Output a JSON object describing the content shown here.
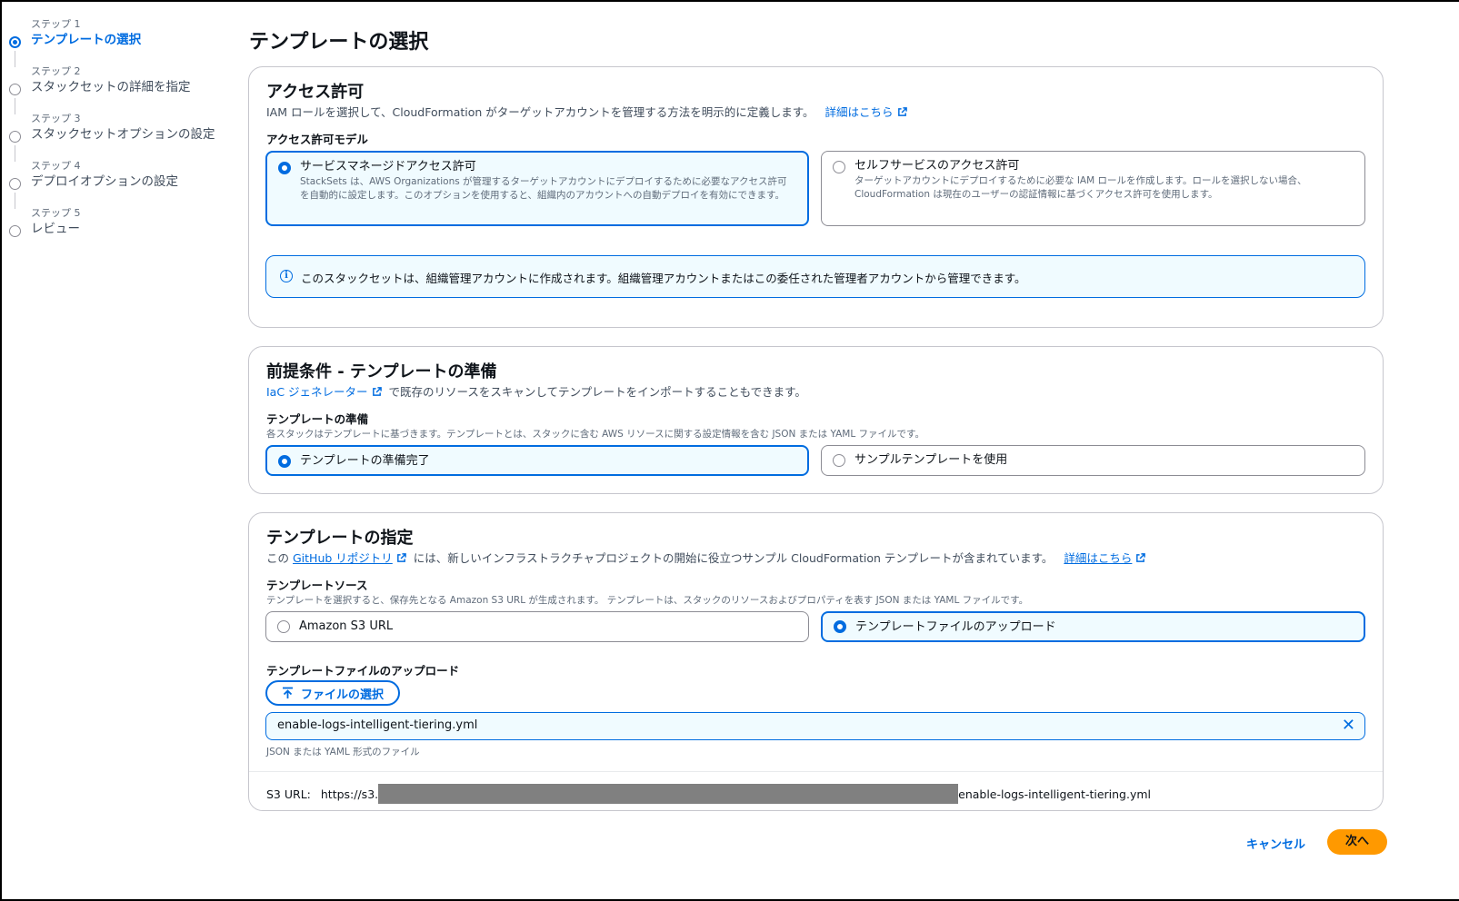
{
  "sidebar": {
    "steps": [
      {
        "num": "ステップ 1",
        "label": "テンプレートの選択"
      },
      {
        "num": "ステップ 2",
        "label": "スタックセットの詳細を指定"
      },
      {
        "num": "ステップ 3",
        "label": "スタックセットオプションの設定"
      },
      {
        "num": "ステップ 4",
        "label": "デプロイオプションの設定"
      },
      {
        "num": "ステップ 5",
        "label": "レビュー"
      }
    ]
  },
  "page": {
    "title": "テンプレートの選択"
  },
  "access": {
    "heading": "アクセス許可",
    "desc": "IAM ロールを選択して、CloudFormation がターゲットアカウントを管理する方法を明示的に定義します。",
    "learn_more": "詳細はこちら",
    "model_label": "アクセス許可モデル",
    "options": [
      {
        "title": "サービスマネージドアクセス許可",
        "desc": "StackSets は、AWS Organizations が管理するターゲットアカウントにデプロイするために必要なアクセス許可を自動的に設定します。このオプションを使用すると、組織内のアカウントへの自動デプロイを有効にできます。"
      },
      {
        "title": "セルフサービスのアクセス許可",
        "desc": "ターゲットアカウントにデプロイするために必要な IAM ロールを作成します。ロールを選択しない場合、CloudFormation は現在のユーザーの認証情報に基づくアクセス許可を使用します。"
      }
    ],
    "info": "このスタックセットは、組織管理アカウントに作成されます。組織管理アカウントまたはこの委任された管理者アカウントから管理できます。"
  },
  "prereq": {
    "heading": "前提条件 - テンプレートの準備",
    "iac_link": "IaC ジェネレーター",
    "iac_desc": "で既存のリソースをスキャンしてテンプレートをインポートすることもできます。",
    "label": "テンプレートの準備",
    "desc": "各スタックはテンプレートに基づきます。テンプレートとは、スタックに含む AWS リソースに関する設定情報を含む JSON または YAML ファイルです。",
    "options": [
      "テンプレートの準備完了",
      "サンプルテンプレートを使用"
    ]
  },
  "spec": {
    "heading": "テンプレートの指定",
    "desc_pre": "この",
    "github_link": "GitHub リポジトリ",
    "desc_post": "には、新しいインフラストラクチャプロジェクトの開始に役立つサンプル CloudFormation テンプレートが含まれています。",
    "learn_more": "詳細はこちら",
    "source_label": "テンプレートソース",
    "source_desc": "テンプレートを選択すると、保存先となる Amazon S3 URL が生成されます。 テンプレートは、スタックのリソースおよびプロパティを表す JSON または YAML ファイルです。",
    "source_options": [
      "Amazon S3 URL",
      "テンプレートファイルのアップロード"
    ],
    "upload_label": "テンプレートファイルのアップロード",
    "choose_file": "ファイルの選択",
    "file_name": "enable-logs-intelligent-tiering.yml",
    "file_hint": "JSON または YAML 形式のファイル",
    "s3_label": "S3 URL:",
    "s3_prefix": "https://s3.",
    "s3_suffix": "enable-logs-intelligent-tiering.yml"
  },
  "footer": {
    "cancel": "キャンセル",
    "next": "次へ"
  },
  "colors": {
    "accent": "#006ce0",
    "primary_button": "#ff9900"
  }
}
